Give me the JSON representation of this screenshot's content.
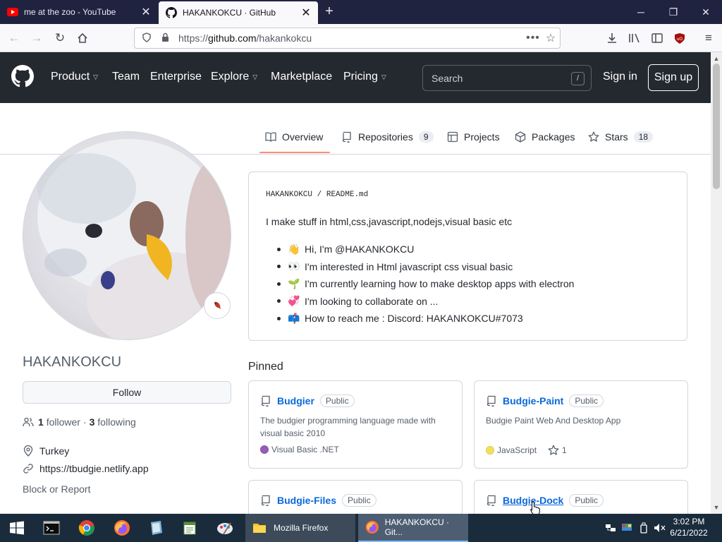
{
  "browser": {
    "tabs": [
      {
        "title": "me at the zoo - YouTube",
        "active": false
      },
      {
        "title": "HAKANKOKCU · GitHub",
        "active": true
      }
    ],
    "url_prefix": "https://",
    "url_domain": "github.com",
    "url_path": "/hakankokcu"
  },
  "gh_header": {
    "nav": [
      "Product",
      "Team",
      "Enterprise",
      "Explore",
      "Marketplace",
      "Pricing"
    ],
    "search_placeholder": "Search",
    "search_shortcut": "/",
    "sign_in": "Sign in",
    "sign_up": "Sign up"
  },
  "profile_tabs": [
    {
      "label": "Overview",
      "count": null,
      "selected": true
    },
    {
      "label": "Repositories",
      "count": "9",
      "selected": false
    },
    {
      "label": "Projects",
      "count": null,
      "selected": false
    },
    {
      "label": "Packages",
      "count": null,
      "selected": false
    },
    {
      "label": "Stars",
      "count": "18",
      "selected": false
    }
  ],
  "profile": {
    "username": "HAKANKOKCU",
    "follow_label": "Follow",
    "followers_count": "1",
    "followers_label": "follower",
    "following_count": "3",
    "following_label": "following",
    "location": "Turkey",
    "website": "https://tbudgie.netlify.app",
    "block_report": "Block or Report"
  },
  "readme": {
    "owner": "HAKANKOKCU",
    "sep": "/",
    "file": "README",
    "ext": ".md",
    "intro": "I make stuff in html,css,javascript,nodejs,visual basic etc",
    "items": [
      {
        "emoji": "👋",
        "text": "Hi, I'm @HAKANKOKCU"
      },
      {
        "emoji": "👀",
        "text": "I'm interested in Html javascript css visual basic"
      },
      {
        "emoji": "🌱",
        "text": "I'm currently learning how to make desktop apps with electron"
      },
      {
        "emoji": "💞",
        "text": "I'm looking to collaborate on ..."
      },
      {
        "emoji": "📫",
        "text": "How to reach me : Discord: HAKANKOKCU#7073"
      }
    ]
  },
  "pinned": {
    "title": "Pinned",
    "repos": [
      {
        "name": "Budgier",
        "visibility": "Public",
        "description": "The budgier programming language made with visual basic 2010",
        "language": "Visual Basic .NET",
        "language_color": "#945db7",
        "stars": null
      },
      {
        "name": "Budgie-Paint",
        "visibility": "Public",
        "description": "Budgie Paint Web And Desktop App",
        "language": "JavaScript",
        "language_color": "#f1e05a",
        "stars": "1"
      },
      {
        "name": "Budgie-Files",
        "visibility": "Public",
        "description": "",
        "language": "",
        "language_color": "",
        "stars": null
      },
      {
        "name": "Budgie-Dock",
        "visibility": "Public",
        "description": "",
        "language": "",
        "language_color": "",
        "stars": null
      }
    ]
  },
  "taskbar": {
    "apps": [
      {
        "label": "Mozilla Firefox"
      },
      {
        "label": "HAKANKOKCU · Git..."
      }
    ],
    "time": "3:02 PM",
    "date": "6/21/2022"
  }
}
